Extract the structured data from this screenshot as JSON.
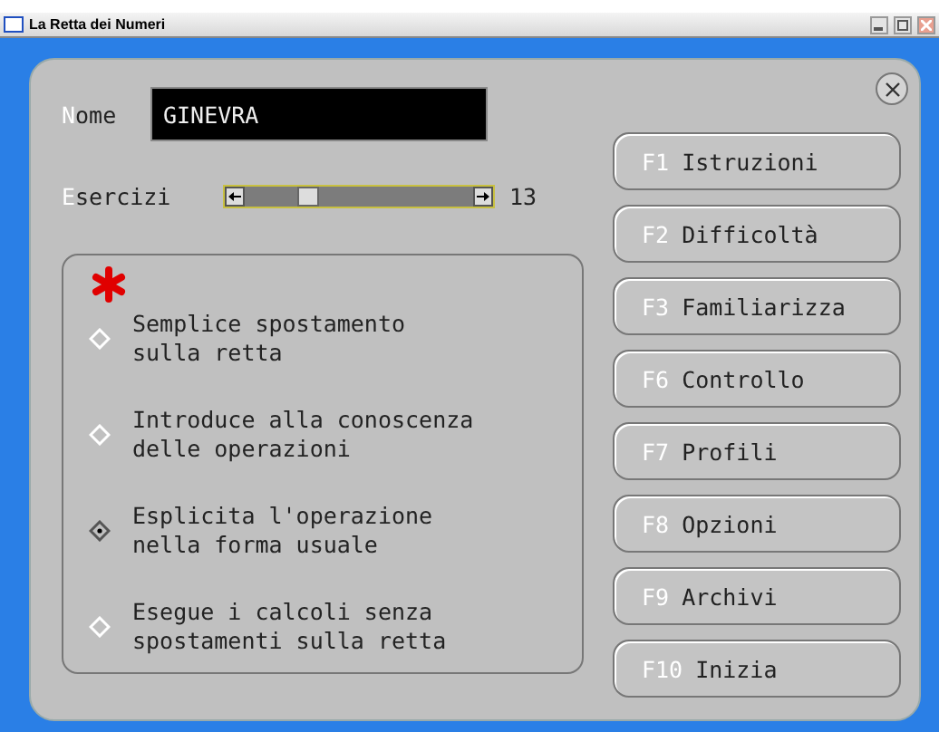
{
  "window": {
    "title": "La Retta dei Numeri"
  },
  "name_field": {
    "label_key": "N",
    "label_rest": "ome",
    "value": "GINEVRA"
  },
  "exercises": {
    "label_key": "E",
    "label_rest": "sercizi",
    "level": 0.28,
    "reading": "13"
  },
  "options": [
    {
      "text": "Semplice spostamento sulla retta",
      "selected": false
    },
    {
      "text": "Introduce alla conoscenza delle operazioni",
      "selected": false
    },
    {
      "text": "Esplicita l'operazione nella forma usuale",
      "selected": true
    },
    {
      "text": "Esegue i calcoli senza spostamenti sulla retta",
      "selected": false
    }
  ],
  "buttons": [
    {
      "key": "F1",
      "label": "Istruzioni"
    },
    {
      "key": "F2",
      "label": "Difficoltà"
    },
    {
      "key": "F3",
      "label": "Familiarizza"
    },
    {
      "key": "F6",
      "label": "Controllo"
    },
    {
      "key": "F7",
      "label": "Profili"
    },
    {
      "key": "F8",
      "label": "Opzioni"
    },
    {
      "key": "F9",
      "label": "Archivi"
    },
    {
      "key": "F10",
      "label": "Inizia"
    }
  ]
}
